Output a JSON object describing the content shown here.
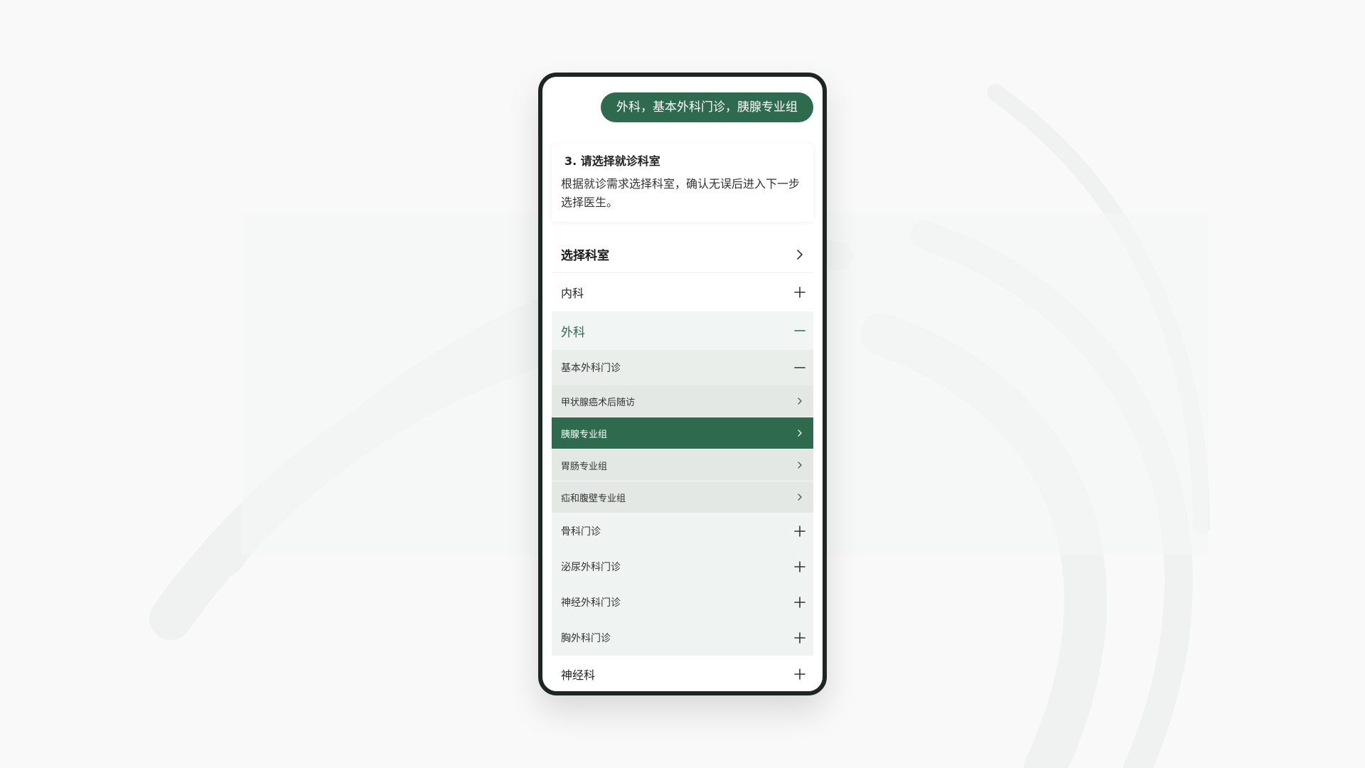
{
  "chat": {
    "selected_path": "外科，基本外科门诊，胰腺专业组"
  },
  "step": {
    "title": "3. 请选择就诊科室",
    "description": "根据就诊需求选择科室，确认无误后进入下一步选择医生。"
  },
  "department_list": {
    "header_label": "选择科室",
    "departments": [
      {
        "label": "内科",
        "state": "collapsed",
        "icon": "plus-icon"
      },
      {
        "label": "外科",
        "state": "expanded",
        "icon": "minus-icon"
      },
      {
        "label": "神经科",
        "state": "collapsed",
        "icon": "plus-icon"
      }
    ],
    "clinics": [
      {
        "label": "基本外科门诊",
        "state": "expanded",
        "icon": "minus-icon"
      },
      {
        "label": "骨科门诊",
        "state": "collapsed",
        "icon": "plus-icon"
      },
      {
        "label": "泌尿外科门诊",
        "state": "collapsed",
        "icon": "plus-icon"
      },
      {
        "label": "神经外科门诊",
        "state": "collapsed",
        "icon": "plus-icon"
      },
      {
        "label": "胸外科门诊",
        "state": "collapsed",
        "icon": "plus-icon"
      }
    ],
    "groups": [
      {
        "label": "甲状腺癌术后随访",
        "selected": false,
        "icon": "chevron-right-icon"
      },
      {
        "label": "胰腺专业组",
        "selected": true,
        "icon": "chevron-right-icon"
      },
      {
        "label": "胃肠专业组",
        "selected": false,
        "icon": "chevron-right-icon"
      },
      {
        "label": "疝和腹壁专业组",
        "selected": false,
        "icon": "chevron-right-icon"
      }
    ]
  },
  "colors": {
    "brand_green": "#2e6a4e",
    "page_background": "#f8f9f8",
    "phone_frame": "#1e2624"
  }
}
